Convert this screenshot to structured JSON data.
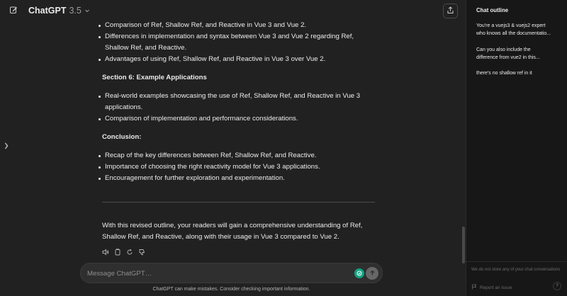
{
  "header": {
    "model_name": "ChatGPT",
    "model_version": "3.5",
    "icons": {
      "new_chat": "edit-icon",
      "model_dropdown": "chevron-down-icon",
      "share": "share-icon",
      "sidebar_toggle": "chevron-right-icon"
    }
  },
  "message": {
    "list1": [
      "Comparison of Ref, Shallow Ref, and Reactive in Vue 3 and Vue 2.",
      "Differences in implementation and syntax between Vue 3 and Vue 2 regarding Ref, Shallow Ref, and Reactive.",
      "Advantages of using Ref, Shallow Ref, and Reactive in Vue 3 over Vue 2."
    ],
    "section6_heading": "Section 6: Example Applications",
    "list2": [
      "Real-world examples showcasing the use of Ref, Shallow Ref, and Reactive in Vue 3 applications.",
      "Comparison of implementation and performance considerations."
    ],
    "conclusion_heading": "Conclusion:",
    "list3": [
      "Recap of the key differences between Ref, Shallow Ref, and Reactive.",
      "Importance of choosing the right reactivity model for Vue 3 applications.",
      "Encouragement for further exploration and experimentation."
    ],
    "closing": "With this revised outline, your readers will gain a comprehensive understanding of Ref, Shallow Ref, and Reactive, along with their usage in Vue 3 compared to Vue 2.",
    "action_icons": [
      "speaker-icon",
      "copy-icon",
      "regenerate-icon",
      "thumbs-down-icon"
    ]
  },
  "composer": {
    "placeholder": "Message ChatGPT…",
    "icons": {
      "extension": "extension-icon",
      "send": "arrow-up-icon"
    }
  },
  "footer": {
    "note": "ChatGPT can make mistakes. Consider checking important information."
  },
  "outline": {
    "title": "Chat outline",
    "items": [
      {
        "line1": "You're a vuejs3 & vuejs2 expert",
        "line2": "who knows all the documentatio..."
      },
      {
        "line1": "Can you also include the",
        "line2": "difference from vue2 in this..."
      },
      {
        "line1": "there's no shallow ref in it",
        "line2": ""
      }
    ],
    "privacy_note": "We do not store any of your chat conversations",
    "report_label": "Report an issue",
    "help_label": "?"
  },
  "colors": {
    "background": "#212121",
    "panel": "#171717",
    "text": "#ececec",
    "muted": "#8e8e8e",
    "extension_accent": "#10a37f"
  }
}
